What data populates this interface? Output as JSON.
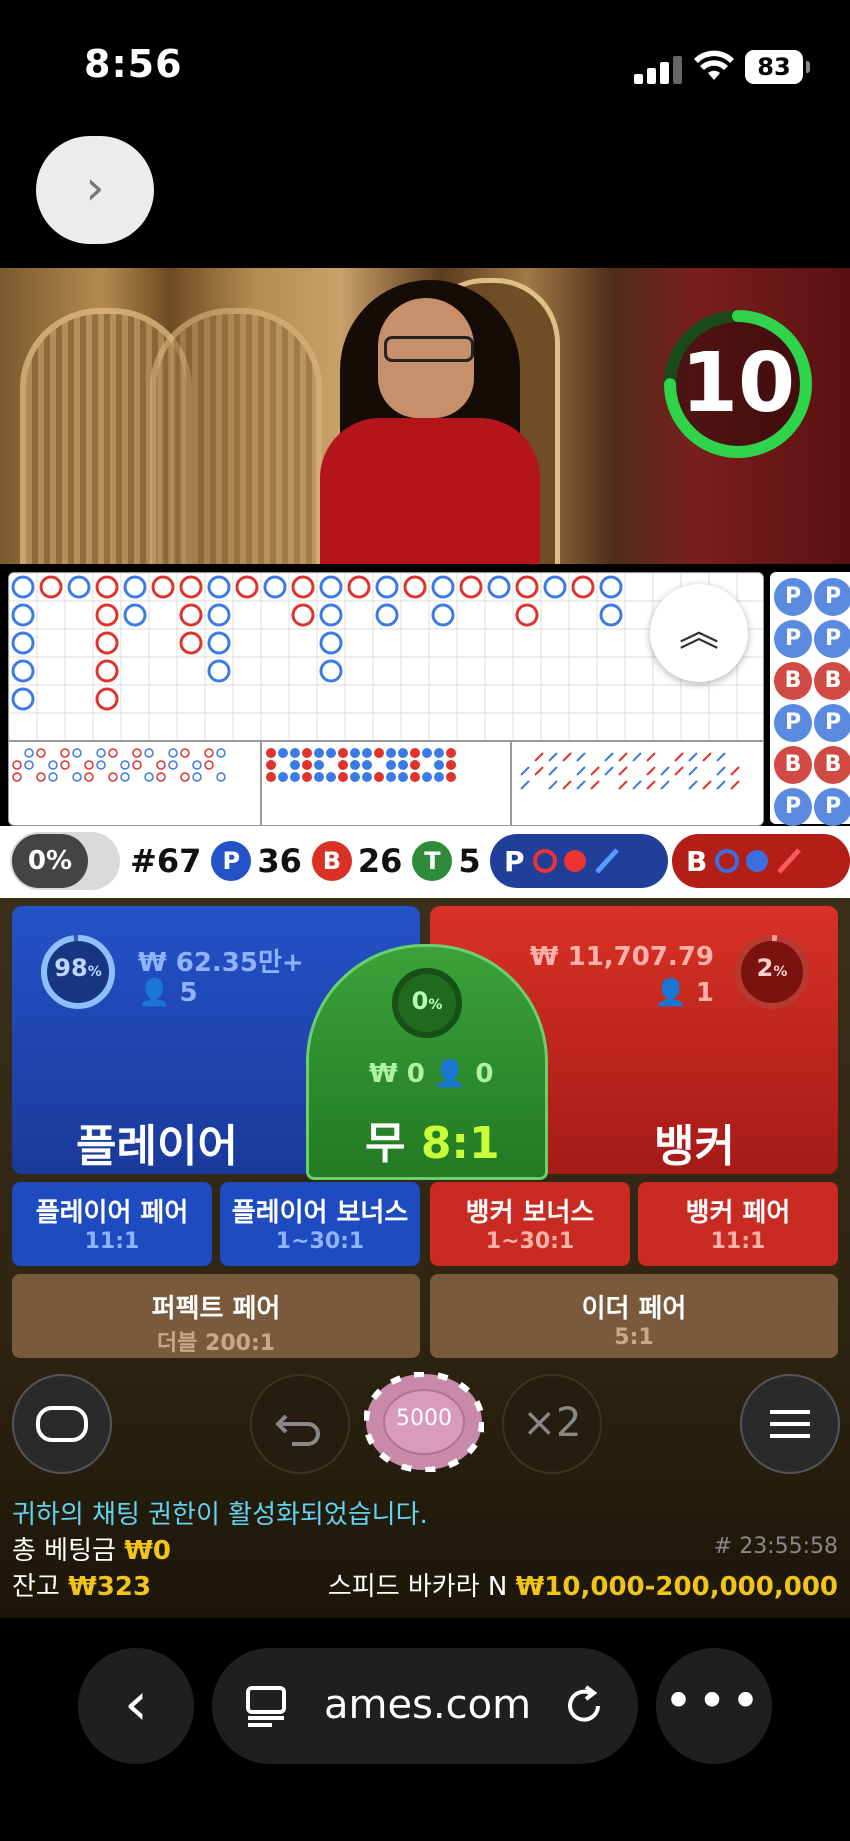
{
  "status_bar": {
    "time": "8:56",
    "battery": "83"
  },
  "video": {
    "timer": "10"
  },
  "stats": {
    "percent": "0%",
    "round": "#67",
    "player_label": "P",
    "player_count": "36",
    "banker_label": "B",
    "banker_count": "26",
    "tie_label": "T",
    "tie_count": "5"
  },
  "predict": {
    "player": "P",
    "banker": "B"
  },
  "bets": {
    "player": {
      "name": "플레이어",
      "percent": "98",
      "pct_sign": "%",
      "amount": "₩ 62.35만+",
      "players": "5",
      "color": "#2452c8"
    },
    "tie": {
      "name": "무",
      "odds": "8:1",
      "percent": "0",
      "pct_sign": "%",
      "amount": "₩ 0",
      "players": "0",
      "color": "#3aa23a"
    },
    "banker": {
      "name": "뱅커",
      "percent": "2",
      "pct_sign": "%",
      "amount": "₩ 11,707.79",
      "players": "1",
      "color": "#d93126"
    }
  },
  "side_bets": [
    {
      "name": "플레이어 페어",
      "odds": "11:1"
    },
    {
      "name": "플레이어 보너스",
      "odds": "1~30:1"
    },
    {
      "name": "뱅커 보너스",
      "odds": "1~30:1"
    },
    {
      "name": "뱅커 페어",
      "odds": "11:1"
    }
  ],
  "extra_bets": [
    {
      "name": "퍼펙트 페어",
      "odds": "더블 200:1"
    },
    {
      "name": "이더 페어",
      "odds": "5:1"
    }
  ],
  "controls": {
    "chip": "5000",
    "double": "×2"
  },
  "message": "귀하의 채팅 권한이 활성화되었습니다.",
  "footer": {
    "total_bet_label": "총 베팅금",
    "total_bet": "₩0",
    "balance_label": "잔고",
    "balance": "₩323",
    "round_id": "# 23:55:58",
    "table_name": "스피드 바카라 N",
    "limits": "₩10,000-200,000,000"
  },
  "browser": {
    "url": "ames.com"
  },
  "icons": {
    "forward": "chevron-right-icon",
    "collapse": "double-chevron-up-icon",
    "chat": "chat-bubble-icon",
    "undo": "undo-icon",
    "menu": "hamburger-menu-icon",
    "back": "chevron-left-icon",
    "tabs": "tabs-icon",
    "reload": "reload-icon",
    "more": "more-dots-icon"
  }
}
